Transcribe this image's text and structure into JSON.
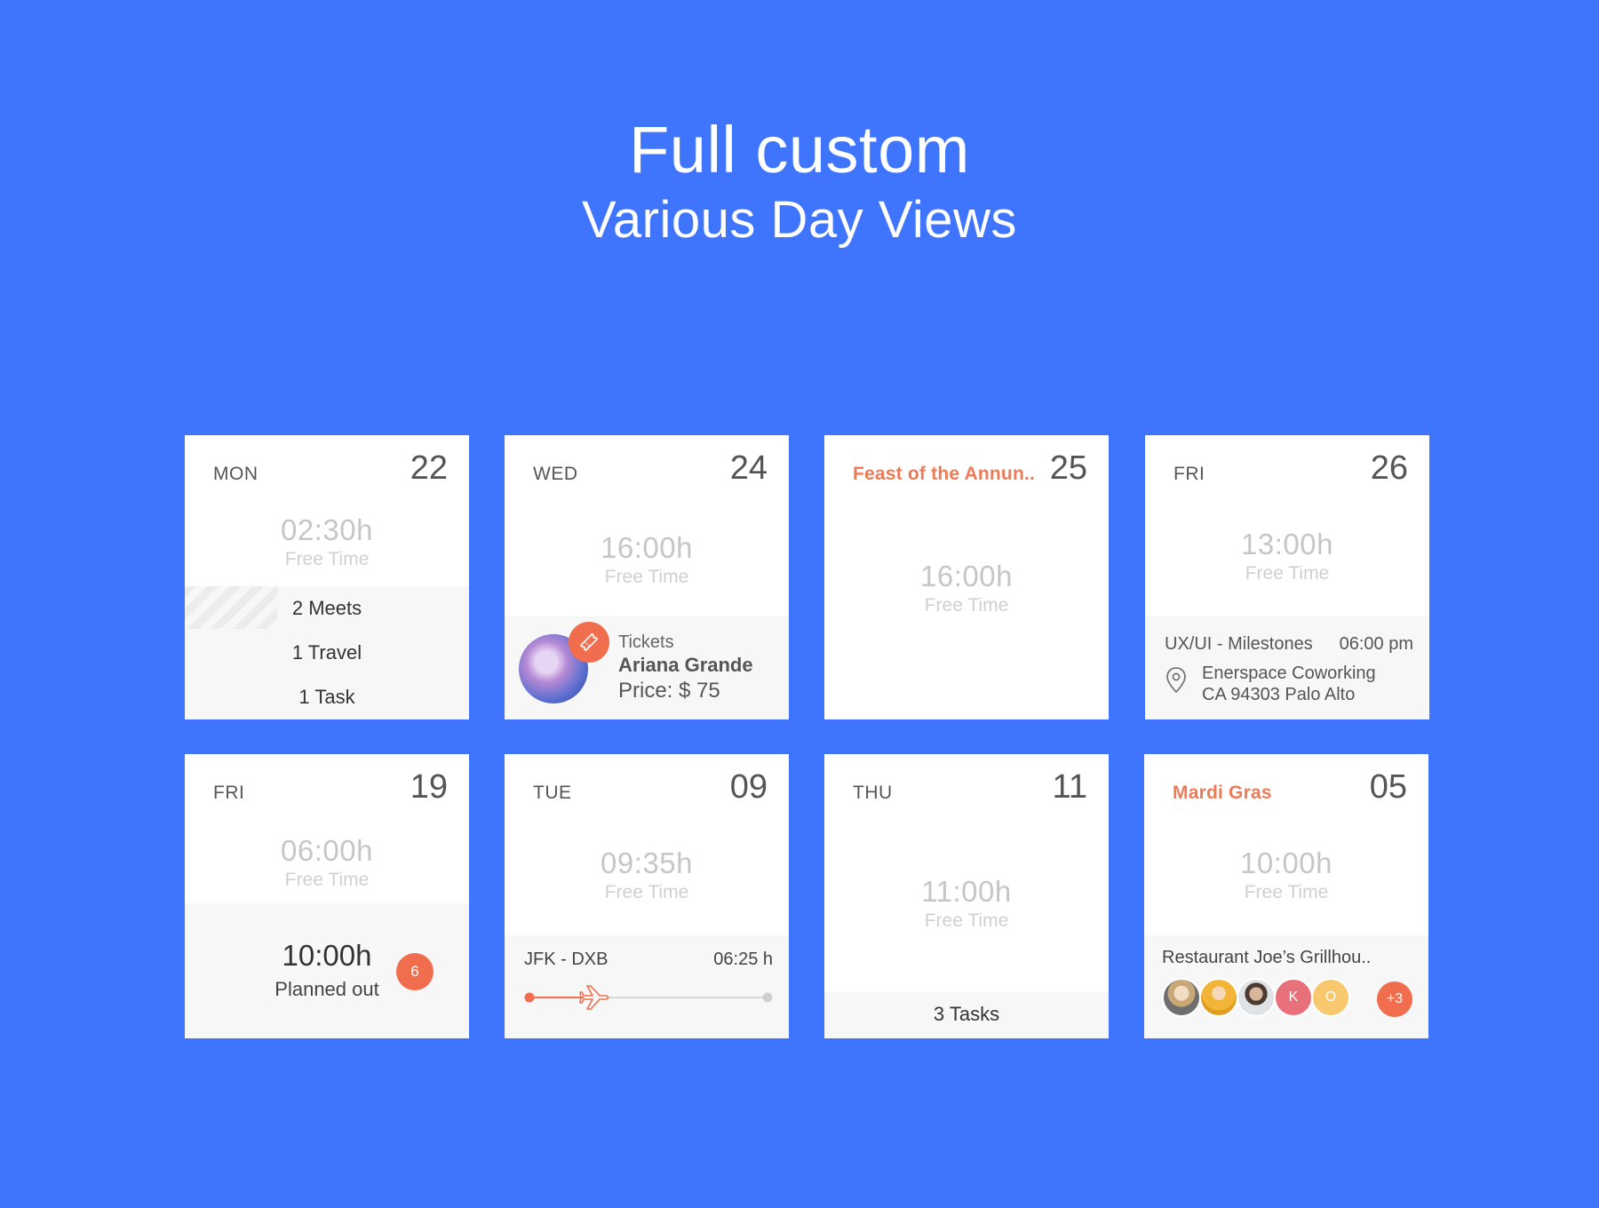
{
  "header": {
    "title": "Full custom",
    "subtitle": "Various Day Views"
  },
  "free_time_label": "Free Time",
  "cards": [
    {
      "dayname": "MON",
      "daynum": "22",
      "free_time": "02:30h",
      "items": [
        "2 Meets",
        "1 Travel",
        "1 Task"
      ]
    },
    {
      "dayname": "WED",
      "daynum": "24",
      "free_time": "16:00h",
      "tickets": {
        "label": "Tickets",
        "name": "Ariana Grande",
        "price": "Price: $ 75"
      }
    },
    {
      "dayname": "Feast of the Annun..",
      "daynum": "25",
      "free_time": "16:00h"
    },
    {
      "dayname": "FRI",
      "daynum": "26",
      "free_time": "13:00h",
      "meeting": {
        "title": "UX/UI - Milestones",
        "time": "06:00 pm",
        "address_line1": "Enerspace Coworking",
        "address_line2": "CA 94303 Palo Alto"
      }
    },
    {
      "dayname": "FRI",
      "daynum": "19",
      "free_time": "06:00h",
      "planned": {
        "time": "10:00h",
        "label": "Planned out",
        "count": "6"
      }
    },
    {
      "dayname": "TUE",
      "daynum": "09",
      "free_time": "09:35h",
      "flight": {
        "route": "JFK - DXB",
        "duration": "06:25 h",
        "progress": 0.28
      }
    },
    {
      "dayname": "THU",
      "daynum": "11",
      "free_time": "11:00h",
      "tasks": "3 Tasks"
    },
    {
      "dayname": "Mardi Gras",
      "daynum": "05",
      "free_time": "10:00h",
      "restaurant": {
        "name": "Restaurant Joe’s Grillhou..",
        "avatar_k": "K",
        "avatar_o": "O",
        "more": "+3"
      }
    }
  ],
  "colors": {
    "background": "#3f75fd",
    "accent": "#ee7b56",
    "badge": "#f06e4d"
  }
}
